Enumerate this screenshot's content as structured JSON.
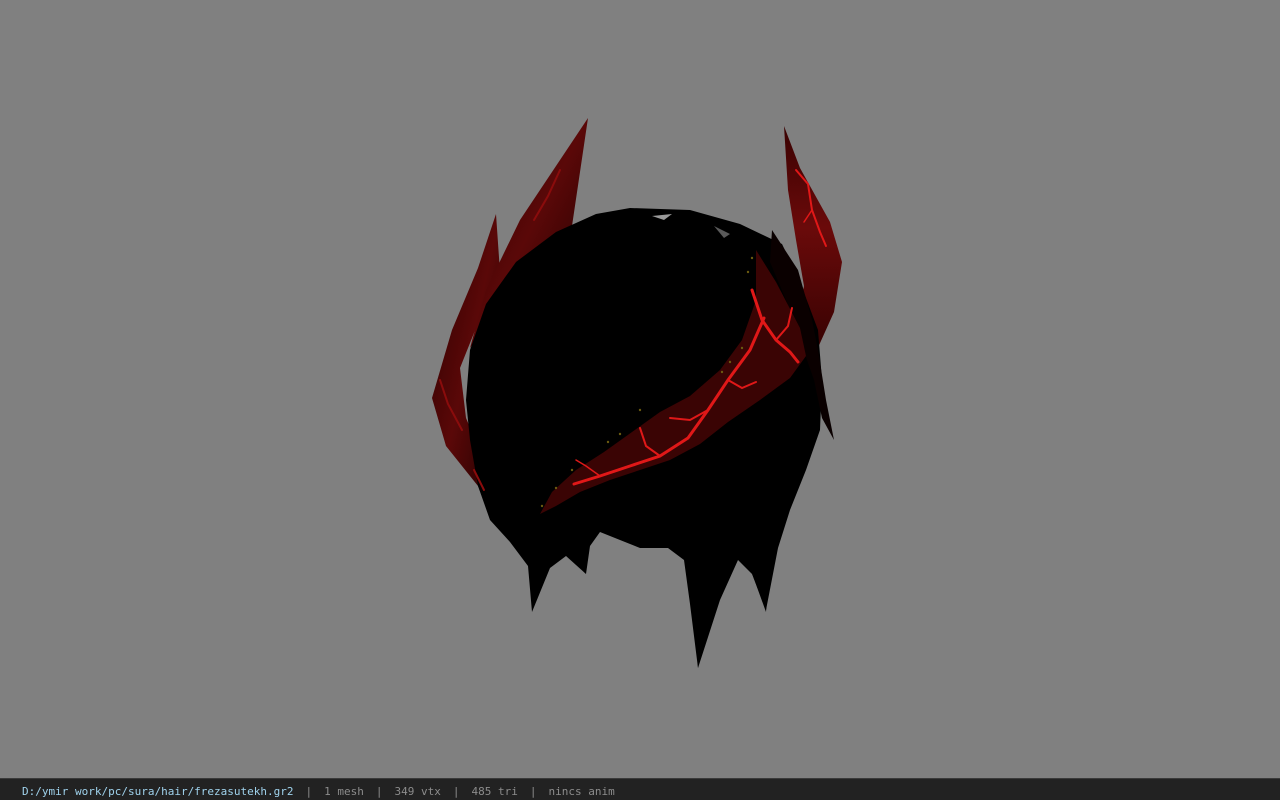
{
  "viewport": {
    "background_color": "#808080",
    "model_description_icon": "hair-mesh-render"
  },
  "statusbar": {
    "file_path": "D:/ymir work/pc/sura/hair/frezasutekh.gr2",
    "separator": "|",
    "mesh_count": "1 mesh",
    "vertex_count": "349 vtx",
    "triangle_count": "485 tri",
    "anim_status": "nincs anim"
  },
  "colors": {
    "statusbar_bg": "#222222",
    "path_text": "#9fd2ec",
    "info_text": "#8c8c8c",
    "model_black": "#000000",
    "lava_red": "#e01010",
    "dark_red": "#4a0606"
  }
}
